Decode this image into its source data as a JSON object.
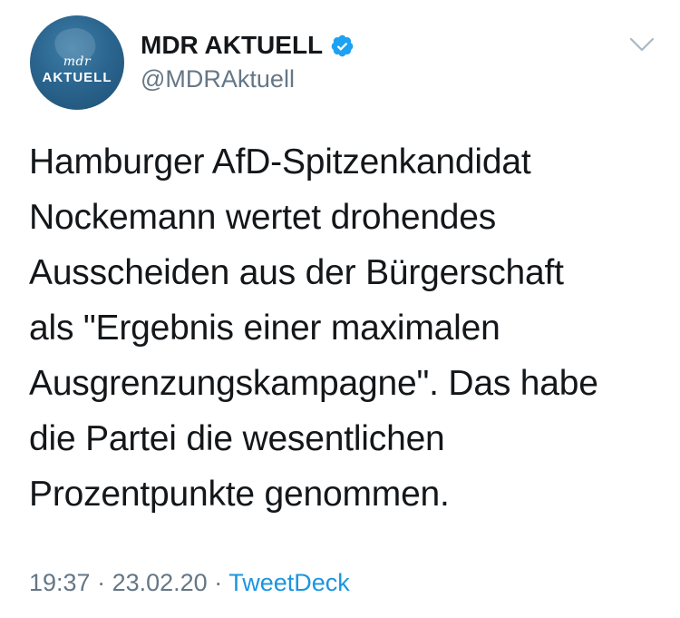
{
  "account": {
    "avatar_logo_text": "mdr",
    "avatar_logo_sub": "AKTUELL",
    "display_name": "MDR AKTUELL",
    "handle": "@MDRAktuell",
    "verified_icon": "verified-badge-icon",
    "menu_icon": "chevron-down-icon"
  },
  "tweet": {
    "lines": [
      "Hamburger AfD-Spitzenkandidat",
      "Nockemann wertet drohendes",
      "Ausscheiden aus der Bürgerschaft",
      "als \"Ergebnis einer maximalen",
      "Ausgrenzungskampagne\". Das habe",
      "die Partei die wesentlichen",
      "Prozentpunkte genommen."
    ]
  },
  "meta": {
    "time": "19:37",
    "separator": " · ",
    "date": "23.02.20",
    "source": "TweetDeck"
  },
  "colors": {
    "text": "#14171a",
    "secondary": "#657786",
    "link": "#1b95e0",
    "verified": "#1da1f2",
    "avatar": "#2b6690"
  }
}
